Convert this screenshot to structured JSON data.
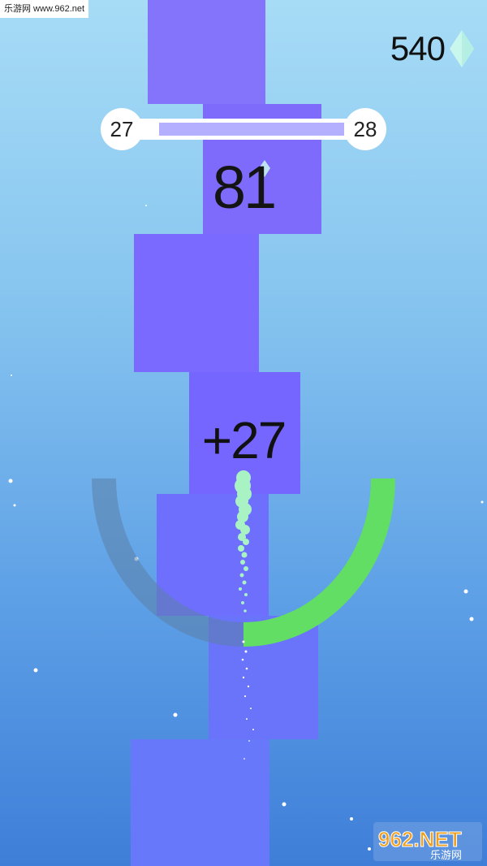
{
  "watermark": {
    "top_text": "乐游网 www.962.net",
    "logo_text": "962.NET",
    "logo_subtext": "乐游网"
  },
  "hud": {
    "gems": "540",
    "current_level": "27",
    "next_level": "28",
    "level_progress": 0.9,
    "score": "81",
    "bonus_popup": "+27"
  },
  "ring": {
    "filled_fraction": 0.5,
    "fill_color": "#62de64",
    "track_color": "#5b7fa7"
  },
  "colors": {
    "sky_top": "#a7dcf6",
    "sky_bottom": "#3f7ed8",
    "tower_block": "#7a6cff",
    "gem": "#c9f7ee",
    "trail": "#a9f2c4"
  },
  "icons": {
    "gem": "diamond-icon"
  }
}
